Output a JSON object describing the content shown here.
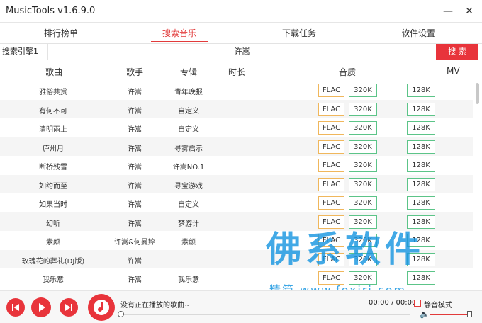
{
  "window": {
    "title": "MusicTools v1.6.9.0",
    "minimize_glyph": "—",
    "close_glyph": "✕"
  },
  "tabs": [
    {
      "label": "排行榜单"
    },
    {
      "label": "搜索音乐"
    },
    {
      "label": "下载任务"
    },
    {
      "label": "软件设置"
    }
  ],
  "search": {
    "engine": "搜索引擎1",
    "query": "许嵩",
    "button": "搜 索"
  },
  "columns": [
    "歌曲",
    "歌手",
    "专辑",
    "时长",
    "音质",
    "MV"
  ],
  "rows": [
    {
      "song": "雅俗共赏",
      "artist": "许嵩",
      "album": "青年晚报",
      "duration": "",
      "flac": "FLAC",
      "q320": "320K",
      "q128": "128K"
    },
    {
      "song": "有何不可",
      "artist": "许嵩",
      "album": "自定义",
      "duration": "",
      "flac": "FLAC",
      "q320": "320K",
      "q128": "128K"
    },
    {
      "song": "清明雨上",
      "artist": "许嵩",
      "album": "自定义",
      "duration": "",
      "flac": "FLAC",
      "q320": "320K",
      "q128": "128K"
    },
    {
      "song": "庐州月",
      "artist": "许嵩",
      "album": "寻雾启示",
      "duration": "",
      "flac": "FLAC",
      "q320": "320K",
      "q128": "128K"
    },
    {
      "song": "断桥残雪",
      "artist": "许嵩",
      "album": "许嵩NO.1",
      "duration": "",
      "flac": "FLAC",
      "q320": "320K",
      "q128": "128K"
    },
    {
      "song": "如约而至",
      "artist": "许嵩",
      "album": "寻宝游戏",
      "duration": "",
      "flac": "FLAC",
      "q320": "320K",
      "q128": "128K"
    },
    {
      "song": "如果当时",
      "artist": "许嵩",
      "album": "自定义",
      "duration": "",
      "flac": "FLAC",
      "q320": "320K",
      "q128": "128K"
    },
    {
      "song": "幻听",
      "artist": "许嵩",
      "album": "梦游计",
      "duration": "",
      "flac": "FLAC",
      "q320": "320K",
      "q128": "128K"
    },
    {
      "song": "素颜",
      "artist": "许嵩&何曼婷",
      "album": "素颜",
      "duration": "",
      "flac": "FLAC",
      "q320": "320K",
      "q128": "128K"
    },
    {
      "song": "玫瑰花的葬礼(DJ版)",
      "artist": "许嵩",
      "album": "",
      "duration": "",
      "flac": "FLAC",
      "q320": "320K",
      "q128": "128K"
    },
    {
      "song": "我乐意",
      "artist": "许嵩",
      "album": "我乐意",
      "duration": "",
      "flac": "FLAC",
      "q320": "320K",
      "q128": "128K"
    }
  ],
  "player": {
    "now_playing": "没有正在播放的歌曲~",
    "time": "00:00 / 00:00",
    "mute_label": "静音模式",
    "progress": 0,
    "volume": 1.0,
    "icons": {
      "prev": "skip-previous-icon",
      "play": "play-icon",
      "next": "skip-next-icon",
      "music": "music-note-icon"
    }
  },
  "watermark": {
    "main": "佛系软件",
    "sub": "精简 www.foxirj.com"
  },
  "colors": {
    "accent": "#e8343b",
    "flac_border": "#f0b75c",
    "kbps_border": "#5cc488"
  }
}
